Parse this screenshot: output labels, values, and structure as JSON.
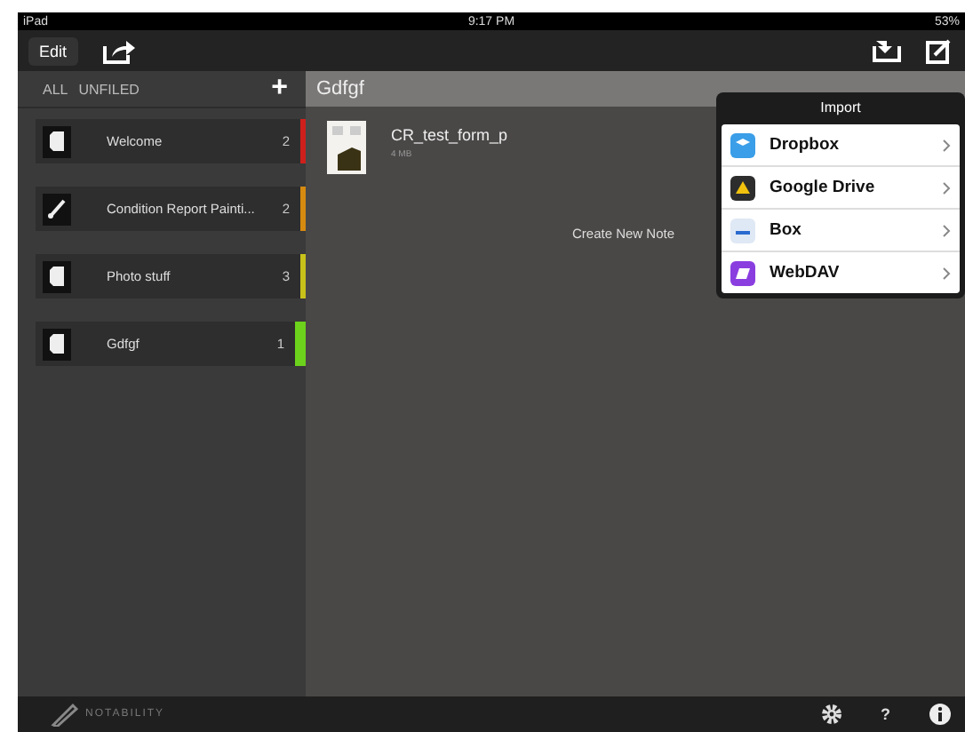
{
  "status_bar": {
    "device": "iPad",
    "time": "9:17 PM",
    "battery": "53%"
  },
  "toolbar": {
    "edit_button": "Edit"
  },
  "sidebar": {
    "tabs": [
      {
        "label": "ALL",
        "selected": false
      },
      {
        "label": "UNFILED",
        "selected": false
      }
    ],
    "add_button": "+",
    "items": [
      {
        "label": "Welcome",
        "count": "2",
        "kind": "notebook",
        "color": "#d0201c",
        "selected": false
      },
      {
        "label": "Condition Report Painti...",
        "count": "2",
        "kind": "brush",
        "color": "#d68a10",
        "selected": false
      },
      {
        "label": "Photo stuff",
        "count": "3",
        "kind": "notebook",
        "color": "#c8c21a",
        "selected": false
      },
      {
        "label": "Gdfgf",
        "count": "1",
        "kind": "notebook",
        "color": "#6cd21c",
        "selected": true
      }
    ]
  },
  "content": {
    "title": "Gdfgf",
    "notes": [
      {
        "name": "CR_test_form_p",
        "size": "4 MB"
      }
    ],
    "create_new_note": "Create New Note"
  },
  "import_popover": {
    "title": "Import",
    "items": [
      {
        "label": "Dropbox",
        "kind": "dropbox"
      },
      {
        "label": "Google Drive",
        "kind": "gdrive"
      },
      {
        "label": "Box",
        "kind": "box"
      },
      {
        "label": "WebDAV",
        "kind": "webdav"
      }
    ]
  },
  "bottom_bar": {
    "logo": "NOTABILITY",
    "help": "?"
  }
}
